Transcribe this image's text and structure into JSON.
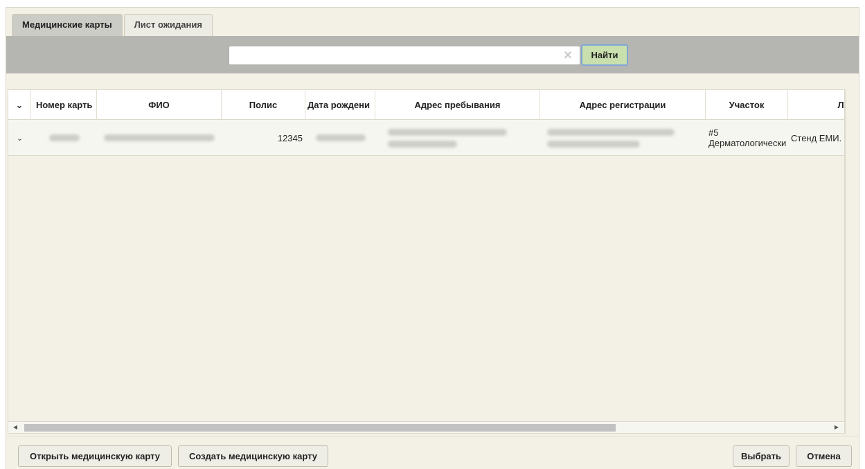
{
  "tabs": [
    {
      "label": "Медицинские карты",
      "active": true
    },
    {
      "label": "Лист ожидания",
      "active": false
    }
  ],
  "search": {
    "value": "",
    "placeholder": "",
    "button_label": "Найти",
    "clear_icon": "×"
  },
  "columns": [
    "Номер карть",
    "ФИО",
    "Полис",
    "Дата рождени",
    "Адрес пребывания",
    "Адрес регистрации",
    "Участок",
    "ЛПУ"
  ],
  "rows": [
    {
      "polis": "12345",
      "uchastok_line1": "#5",
      "uchastok_line2": "Дерматологически",
      "lpu": "Стенд ЕМИ."
    }
  ],
  "footer": {
    "open_card": "Открыть медицинскую карту",
    "create_card": "Создать медицинскую карту",
    "select": "Выбрать",
    "cancel": "Отмена"
  }
}
